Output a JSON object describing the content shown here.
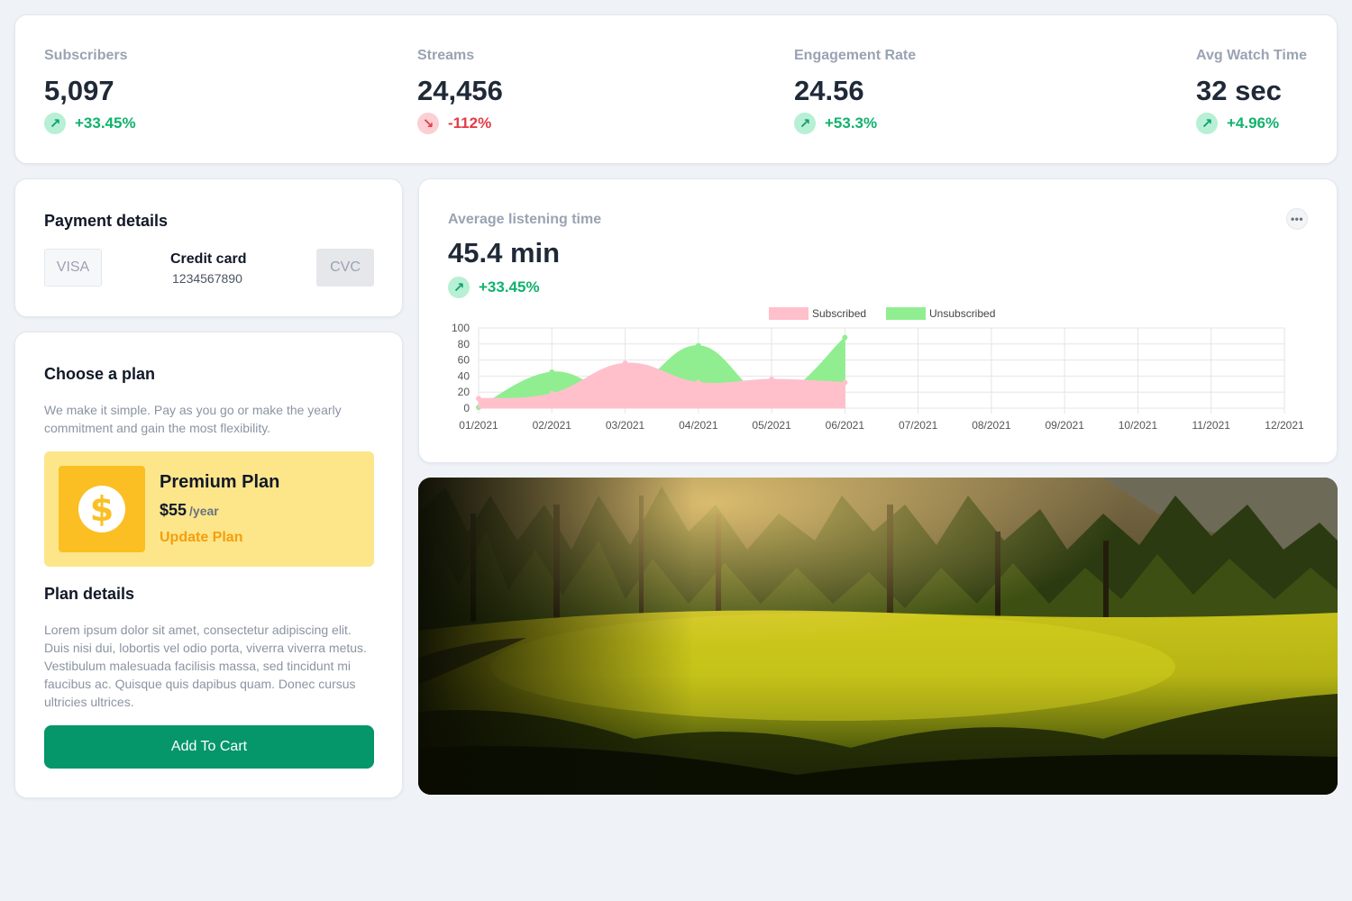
{
  "stats": [
    {
      "label": "Subscribers",
      "value": "5,097",
      "change": "+33.45%",
      "direction": "up"
    },
    {
      "label": "Streams",
      "value": "24,456",
      "change": "-112%",
      "direction": "down"
    },
    {
      "label": "Engagement Rate",
      "value": "24.56",
      "change": "+53.3%",
      "direction": "up"
    },
    {
      "label": "Avg Watch Time",
      "value": "32 sec",
      "change": "+4.96%",
      "direction": "up"
    }
  ],
  "icons": {
    "up": "arrow-up-right-icon",
    "down": "arrow-down-right-icon",
    "more": "more-horizontal-icon",
    "coin": "dollar-coin-icon"
  },
  "payment": {
    "title": "Payment details",
    "visa_label": "VISA",
    "card_title": "Credit card",
    "card_number": "1234567890",
    "cvc_label": "CVC"
  },
  "plan": {
    "title": "Choose a plan",
    "description": "We make it simple. Pay as you go or make the yearly commitment and gain the most flexibility.",
    "premium": {
      "name": "Premium Plan",
      "price": "$55",
      "period": "/year",
      "update_label": "Update Plan"
    },
    "details_title": "Plan details",
    "details_text": "Lorem ipsum dolor sit amet, consectetur adipiscing elit. Duis nisi dui, lobortis vel odio porta, viverra viverra metus. Vestibulum malesuada facilisis massa, sed tincidunt mi faucibus ac. Quisque quis dapibus quam. Donec cursus ultricies ultrices.",
    "cart_button": "Add To Cart"
  },
  "listening": {
    "label": "Average listening time",
    "value": "45.4 min",
    "change": "+33.45%",
    "direction": "up"
  },
  "colors": {
    "subscribed": "#ffc0cb",
    "unsubscribed": "#90ee90",
    "up": "#10b26c",
    "down": "#e23c48",
    "primary_button": "#059669",
    "plan_card": "#fde68a"
  },
  "chart_data": {
    "type": "area",
    "categories": [
      "01/2021",
      "02/2021",
      "03/2021",
      "04/2021",
      "05/2021",
      "06/2021",
      "07/2021",
      "08/2021",
      "09/2021",
      "10/2021",
      "11/2021",
      "12/2021"
    ],
    "series": [
      {
        "name": "Subscribed",
        "values": [
          12,
          18,
          56,
          32,
          36,
          32,
          null,
          null,
          null,
          null,
          null,
          null
        ],
        "color": "#ffc0cb"
      },
      {
        "name": "Unsubscribed",
        "values": [
          1,
          45,
          20,
          78,
          14,
          88,
          null,
          null,
          null,
          null,
          null,
          null
        ],
        "color": "#90ee90"
      }
    ],
    "yticks": [
      0,
      20,
      40,
      60,
      80,
      100
    ],
    "ylim": [
      0,
      100
    ],
    "legend": "top-center",
    "grid": true
  },
  "photo": {
    "name": "forest-meadow-photo"
  }
}
